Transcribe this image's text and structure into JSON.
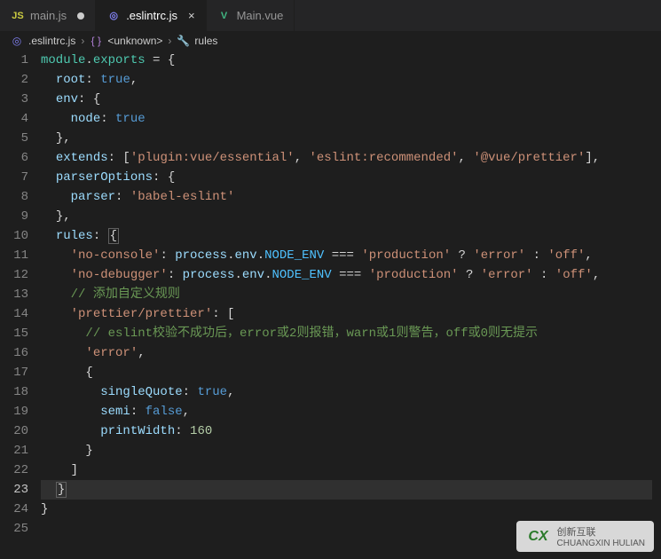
{
  "tabs": [
    {
      "label": "main.js",
      "iconClass": "icon-js",
      "iconGlyph": "JS",
      "active": false,
      "modified": true
    },
    {
      "label": ".eslintrc.js",
      "iconClass": "icon-eslint",
      "iconGlyph": "◎",
      "active": true,
      "modified": false
    },
    {
      "label": "Main.vue",
      "iconClass": "icon-vue",
      "iconGlyph": "V",
      "active": false,
      "modified": false
    }
  ],
  "breadcrumbs": {
    "file": ".eslintrc.js",
    "part2": "<unknown>",
    "part3": "rules"
  },
  "lineCount": 25,
  "code": {
    "l1": {
      "module": "module",
      "exports": "exports",
      "rest": " = {"
    },
    "l2": {
      "key": "root",
      "val": "true"
    },
    "l3": {
      "key": "env",
      "rest": ": {"
    },
    "l4": {
      "key": "node",
      "val": "true"
    },
    "l5": "},",
    "l6": {
      "key": "extends",
      "a": "'plugin:vue/essential'",
      "b": "'eslint:recommended'",
      "c": "'@vue/prettier'"
    },
    "l7": {
      "key": "parserOptions",
      "rest": ": {"
    },
    "l8": {
      "key": "parser",
      "val": "'babel-eslint'"
    },
    "l9": "},",
    "l10": {
      "key": "rules"
    },
    "l11": {
      "key": "'no-console'",
      "p1": "process",
      "p2": "env",
      "p3": "NODE_ENV",
      "s1": "'production'",
      "s2": "'error'",
      "s3": "'off'"
    },
    "l12": {
      "key": "'no-debugger'",
      "p1": "process",
      "p2": "env",
      "p3": "NODE_ENV",
      "s1": "'production'",
      "s2": "'error'",
      "s3": "'off'"
    },
    "l13": "// 添加自定义规则",
    "l14": {
      "key": "'prettier/prettier'"
    },
    "l15": "// eslint校验不成功后，error或2则报错，warn或1则警告，off或0则无提示",
    "l16": "'error'",
    "l17": "{",
    "l18": {
      "key": "singleQuote",
      "val": "true"
    },
    "l19": {
      "key": "semi",
      "val": "false"
    },
    "l20": {
      "key": "printWidth",
      "val": "160"
    },
    "l21": "}",
    "l22": "]",
    "l23": "}",
    "l24": "}",
    "l25": ""
  },
  "watermark": {
    "logo": "CX",
    "line1": "创新互联",
    "line2": "CHUANGXIN HULIAN"
  }
}
